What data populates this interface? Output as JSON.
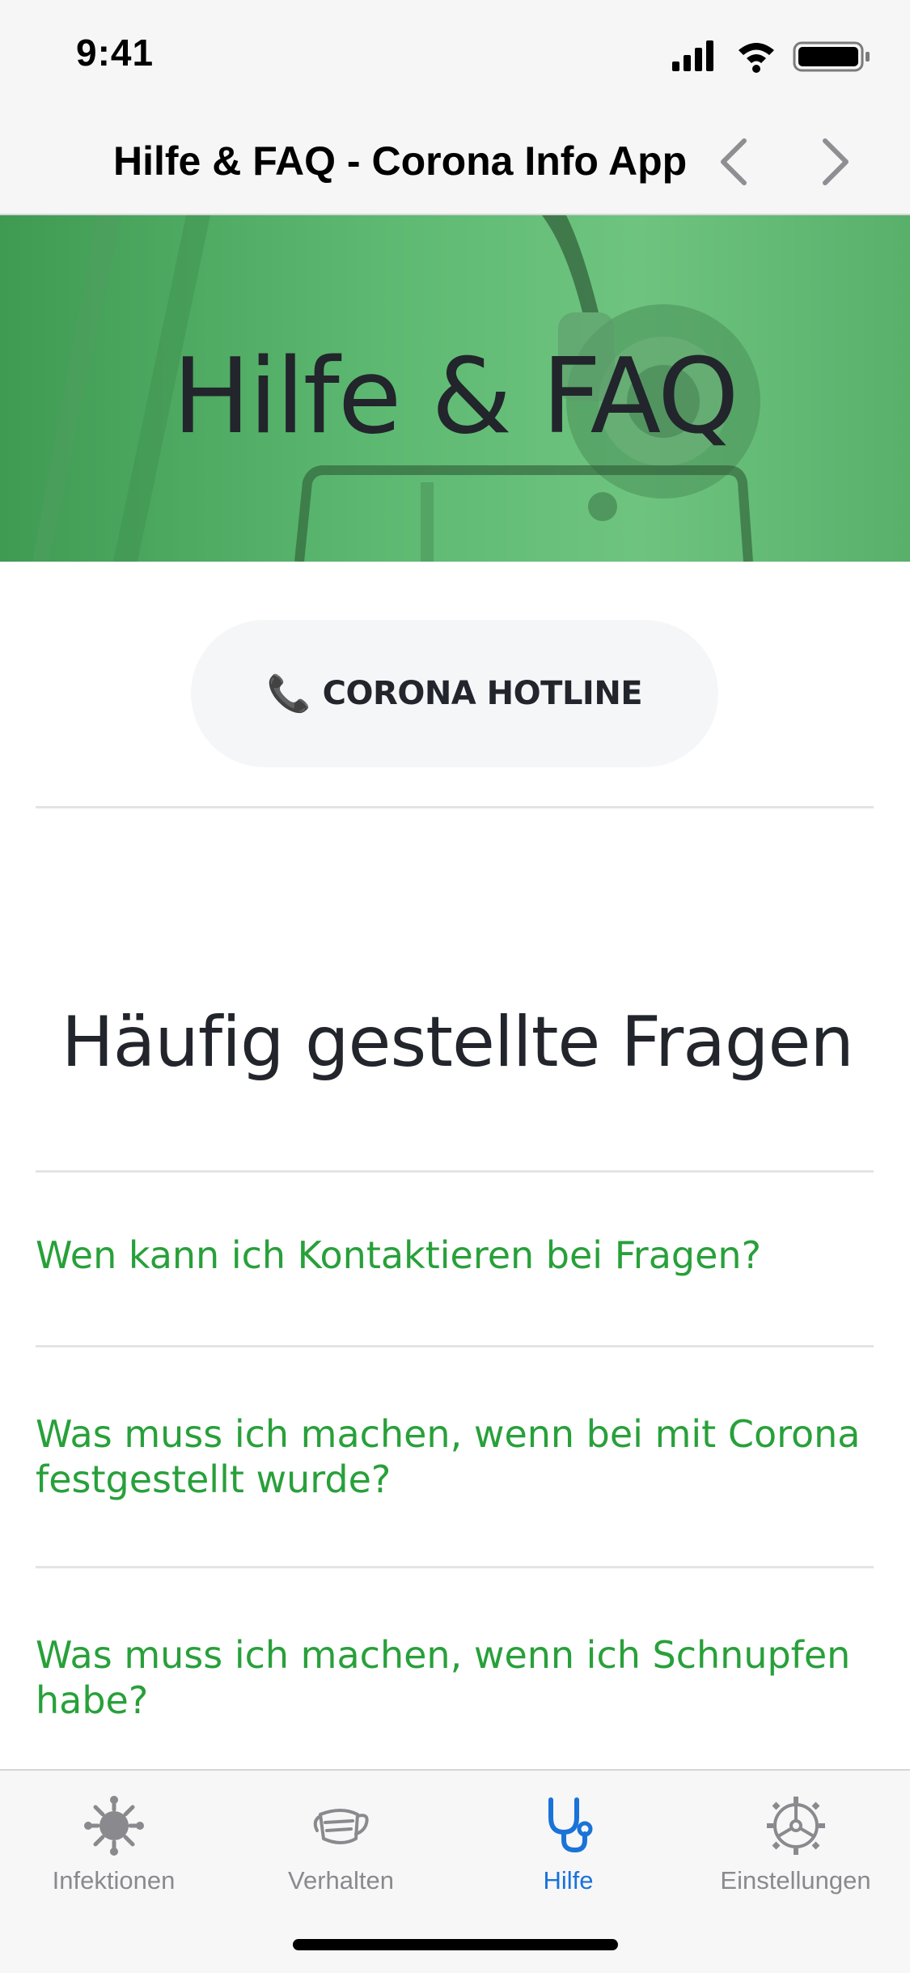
{
  "status_bar": {
    "time": "9:41",
    "icons": [
      "cellular-signal-icon",
      "wifi-icon",
      "battery-icon"
    ]
  },
  "nav": {
    "title": "Hilfe & FAQ - Corona Info App",
    "back_icon": "chevron-left-icon",
    "forward_icon": "chevron-right-icon"
  },
  "hero": {
    "title": "Hilfe & FAQ",
    "background_image": "stethoscope photo with green overlay"
  },
  "hotline": {
    "icon": "phone-icon",
    "label": "CORONA HOTLINE"
  },
  "faq": {
    "heading": "Häufig gestellte Fragen",
    "items": [
      {
        "question": "Wen kann ich Kontaktieren bei Fragen?"
      },
      {
        "question": "Was muss ich machen, wenn bei mit Corona festgestellt wurde?"
      },
      {
        "question": "Was muss ich machen, wenn ich Schnupfen habe?"
      }
    ]
  },
  "tab_bar": {
    "tabs": [
      {
        "label": "Infektionen",
        "icon": "virus-icon",
        "active": false
      },
      {
        "label": "Verhalten",
        "icon": "mask-icon",
        "active": false
      },
      {
        "label": "Hilfe",
        "icon": "stethoscope-icon",
        "active": true
      },
      {
        "label": "Einstellungen",
        "icon": "settings-wheel-icon",
        "active": false
      }
    ]
  },
  "colors": {
    "accent_green": "#28a03a",
    "hero_green": "#5cb870",
    "active_tab_blue": "#1a73d9",
    "inactive_tab_gray": "#8a8a8e",
    "text_dark": "#22252b"
  }
}
